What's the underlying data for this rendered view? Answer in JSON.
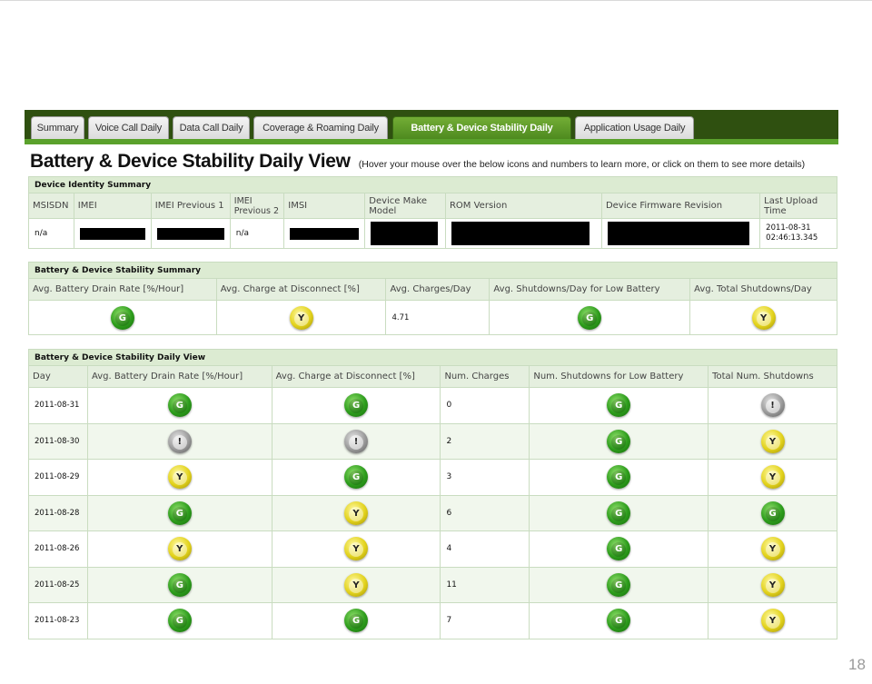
{
  "tabs": [
    {
      "label": "Summary"
    },
    {
      "label": "Voice Call Daily"
    },
    {
      "label": "Data Call Daily"
    },
    {
      "label": "Coverage & Roaming Daily"
    },
    {
      "label": "Battery & Device Stability Daily"
    },
    {
      "label": "Application Usage Daily"
    }
  ],
  "active_tab": "Battery & Device Stability Daily",
  "page_title": "Battery & Device Stability Daily View",
  "page_hint": "(Hover your mouse over the below icons and numbers to learn more, or click on them to see more details)",
  "identity": {
    "section_title": "Device Identity Summary",
    "headers": [
      "MSISDN",
      "IMEI",
      "IMEI Previous 1",
      "IMEI Previous 2",
      "IMSI",
      "Device Make Model",
      "ROM Version",
      "Device Firmware Revision",
      "Last Upload Time"
    ],
    "msisdn": "n/a",
    "imei_prev2": "n/a",
    "last_upload": "2011-08-31 02:46:13.345"
  },
  "summary": {
    "section_title": "Battery & Device Stability Summary",
    "headers": [
      "Avg. Battery Drain Rate [%/Hour]",
      "Avg. Charge at Disconnect [%]",
      "Avg. Charges/Day",
      "Avg. Shutdowns/Day for Low Battery",
      "Avg. Total Shutdowns/Day"
    ],
    "drain_status": "G",
    "charge_status": "Y",
    "charges_per_day": "4.71",
    "low_batt_status": "G",
    "total_shutdowns_status": "Y"
  },
  "daily": {
    "section_title": "Battery & Device Stability Daily View",
    "headers": [
      "Day",
      "Avg. Battery Drain Rate [%/Hour]",
      "Avg. Charge at Disconnect [%]",
      "Num. Charges",
      "Num. Shutdowns for Low Battery",
      "Total Num. Shutdowns"
    ],
    "rows": [
      {
        "day": "2011-08-31",
        "drain": "G",
        "charge": "G",
        "charges": "0",
        "low": "G",
        "total": "!"
      },
      {
        "day": "2011-08-30",
        "drain": "!",
        "charge": "!",
        "charges": "2",
        "low": "G",
        "total": "Y"
      },
      {
        "day": "2011-08-29",
        "drain": "Y",
        "charge": "G",
        "charges": "3",
        "low": "G",
        "total": "Y"
      },
      {
        "day": "2011-08-28",
        "drain": "G",
        "charge": "Y",
        "charges": "6",
        "low": "G",
        "total": "G"
      },
      {
        "day": "2011-08-26",
        "drain": "Y",
        "charge": "Y",
        "charges": "4",
        "low": "G",
        "total": "Y"
      },
      {
        "day": "2011-08-25",
        "drain": "G",
        "charge": "Y",
        "charges": "11",
        "low": "G",
        "total": "Y"
      },
      {
        "day": "2011-08-23",
        "drain": "G",
        "charge": "G",
        "charges": "7",
        "low": "G",
        "total": "Y"
      }
    ]
  },
  "colors": {
    "tab_bar": "#2f5010",
    "accent_green": "#5aa12c",
    "section_bg": "#dcebd2",
    "link_green": "#3a8a1a"
  },
  "status_icons": {
    "G": "green-status-icon",
    "Y": "yellow-status-icon",
    "!": "warning-status-icon"
  },
  "page_number": "18"
}
